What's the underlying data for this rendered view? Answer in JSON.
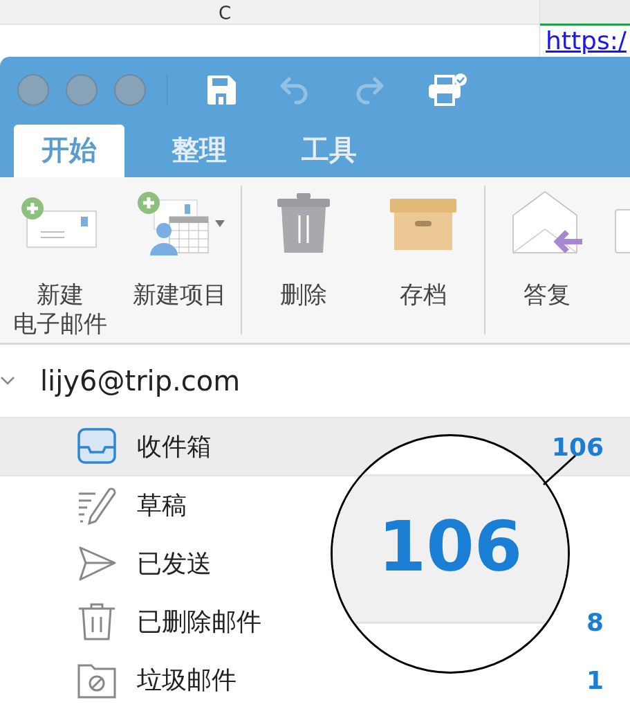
{
  "browser": {
    "cell_text": "C",
    "link": "https:/"
  },
  "window": {
    "quick_access": [
      {
        "kind": "save",
        "disabled": false
      },
      {
        "kind": "undo",
        "disabled": true
      },
      {
        "kind": "redo",
        "disabled": true
      },
      {
        "kind": "print",
        "disabled": false
      }
    ],
    "tabs": [
      {
        "label": "开始",
        "selected": true
      },
      {
        "label": "整理",
        "selected": false
      },
      {
        "label": "工具",
        "selected": false
      }
    ]
  },
  "ribbon": {
    "groups": [
      [
        {
          "kind": "new-mail",
          "label": [
            "新建",
            "电子邮件"
          ],
          "dropdown": false
        },
        {
          "kind": "new-item",
          "label": [
            "新建项目"
          ],
          "dropdown": true
        }
      ],
      [
        {
          "kind": "delete",
          "label": [
            "删除"
          ],
          "dropdown": false
        },
        {
          "kind": "archive",
          "label": [
            "存档"
          ],
          "dropdown": false
        }
      ],
      [
        {
          "kind": "reply",
          "label": [
            "答复"
          ],
          "dropdown": false
        }
      ]
    ]
  },
  "account": {
    "name": "lijy6@trip.com",
    "expanded": true
  },
  "folders": [
    {
      "kind": "inbox",
      "name": "收件箱",
      "count": "106",
      "selected": true
    },
    {
      "kind": "drafts",
      "name": "草稿",
      "selected": false
    },
    {
      "kind": "sent",
      "name": "已发送",
      "selected": false
    },
    {
      "kind": "deleted",
      "name": "已删除邮件",
      "count": "8",
      "selected": false
    },
    {
      "kind": "junk",
      "name": "垃圾邮件",
      "count": "1",
      "selected": false
    }
  ],
  "magnifier": {
    "text": "106"
  }
}
